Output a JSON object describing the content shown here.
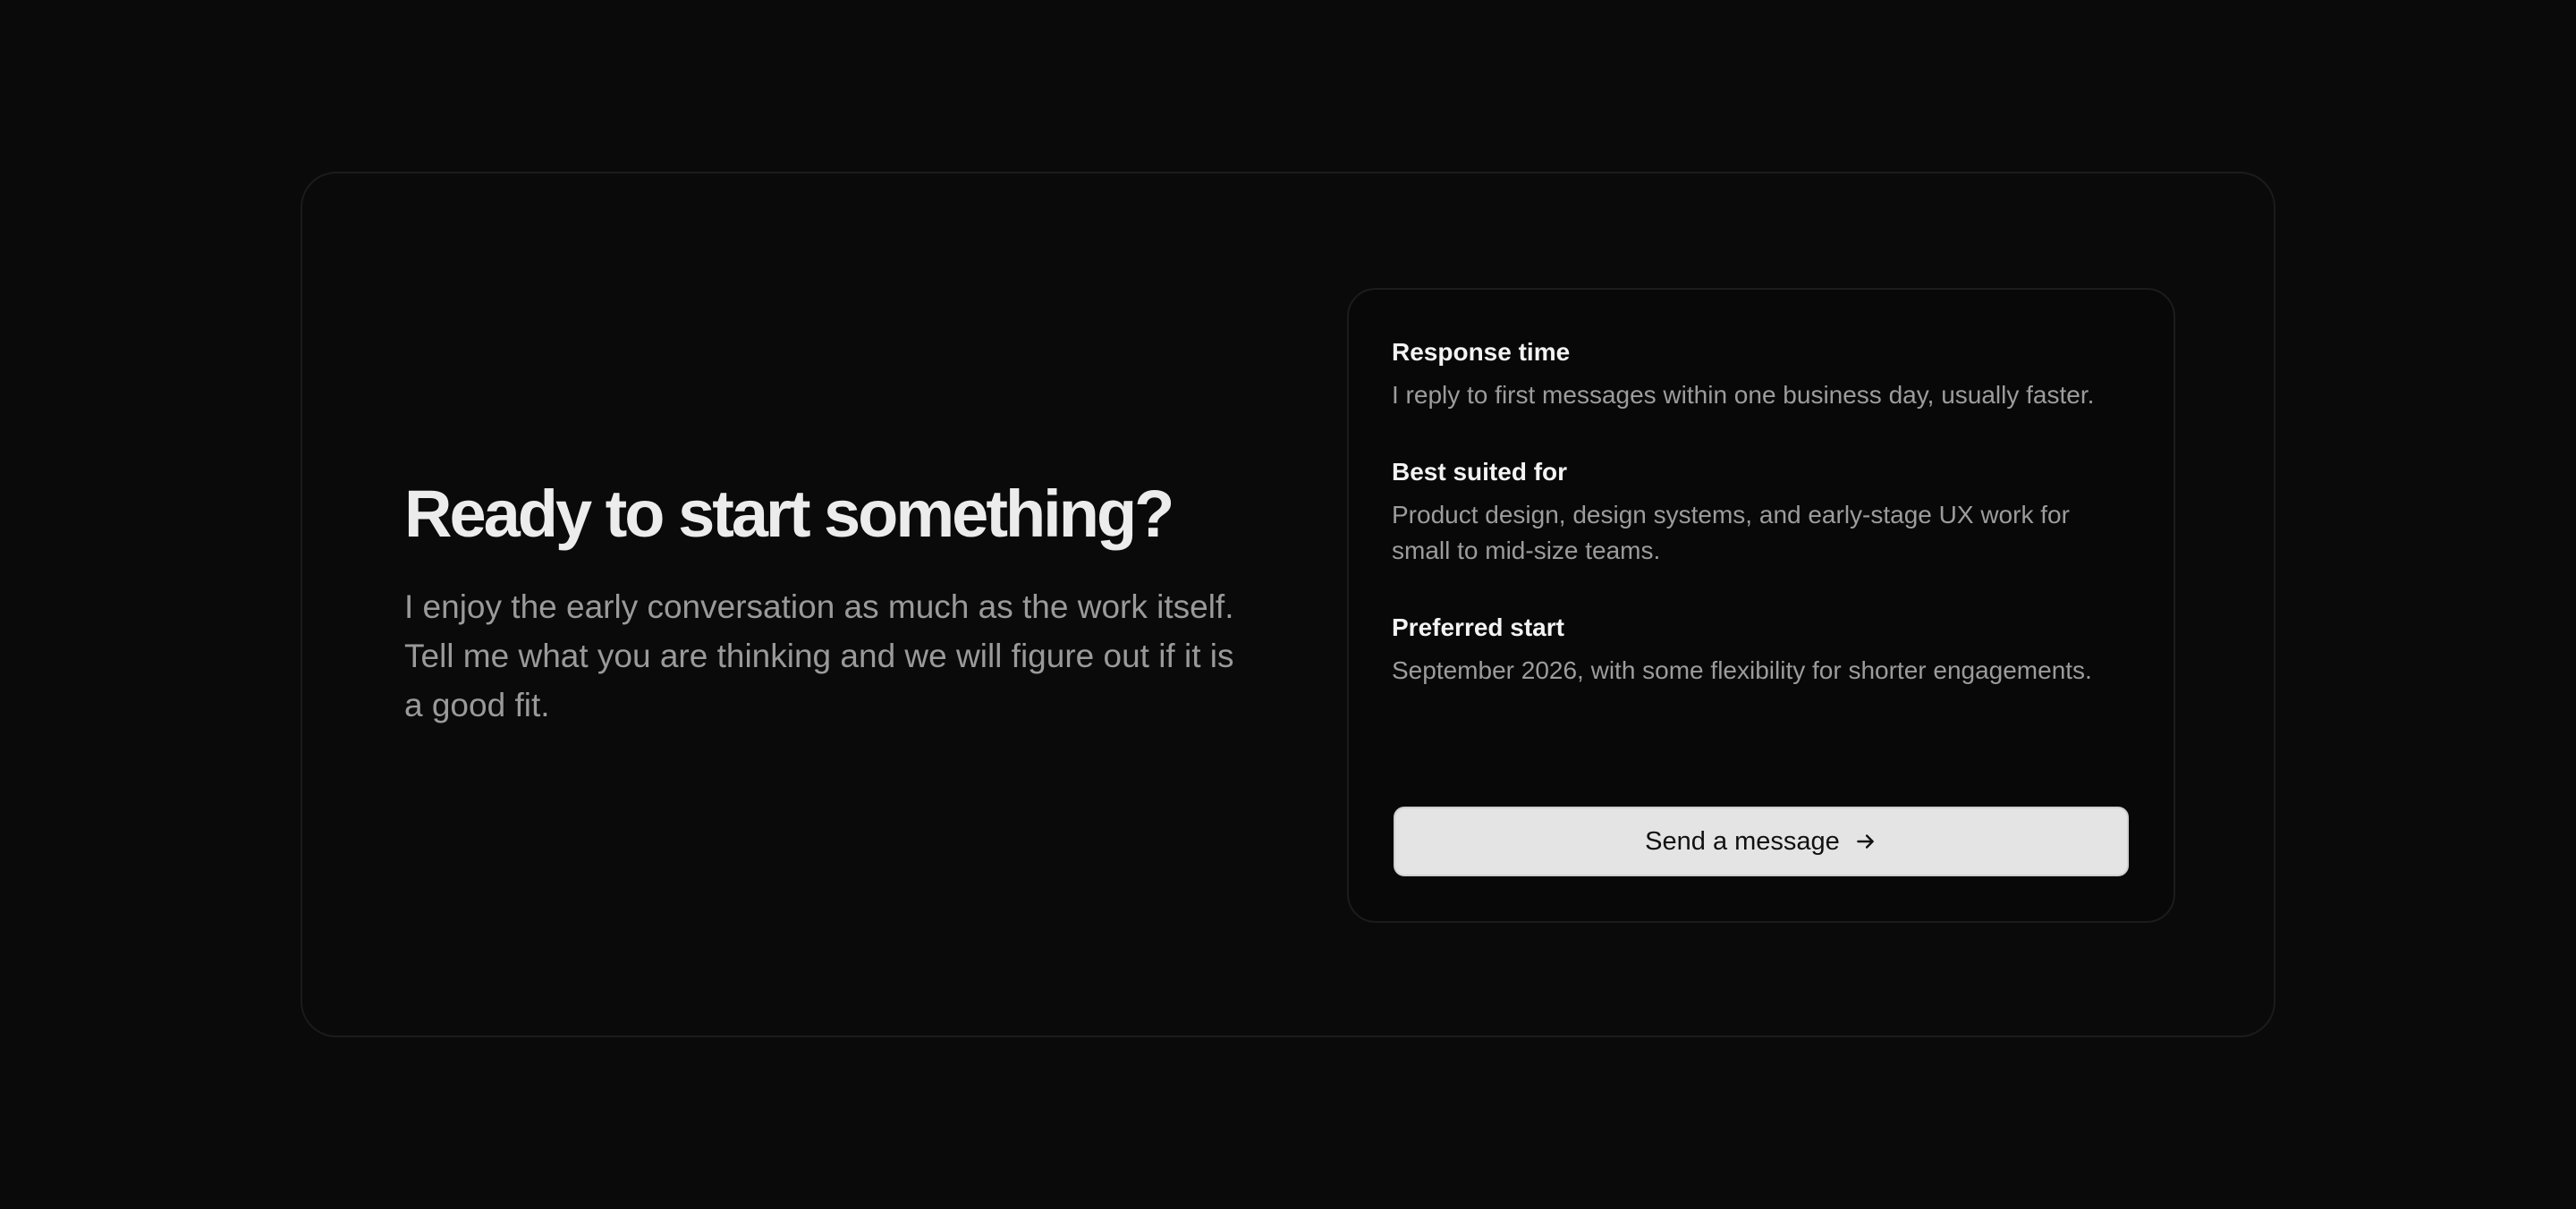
{
  "hero": {
    "title": "Ready to start something?",
    "subtitle": "I enjoy the early conversation as much as the work itself. Tell me what you are thinking and we will figure out if it is a good fit."
  },
  "details": [
    {
      "title": "Response time",
      "text": "I reply to first messages within one business day, usually faster."
    },
    {
      "title": "Best suited for",
      "text": "Product design, design systems, and early-stage UX work for small to mid-size teams."
    },
    {
      "title": "Preferred start",
      "text": "September 2026, with some flexibility for shorter engagements."
    }
  ],
  "cta": {
    "label": "Send a message",
    "icon": "arrow-right-icon"
  },
  "colors": {
    "background": "#0a0a0a",
    "button": "#e4e4e4"
  }
}
